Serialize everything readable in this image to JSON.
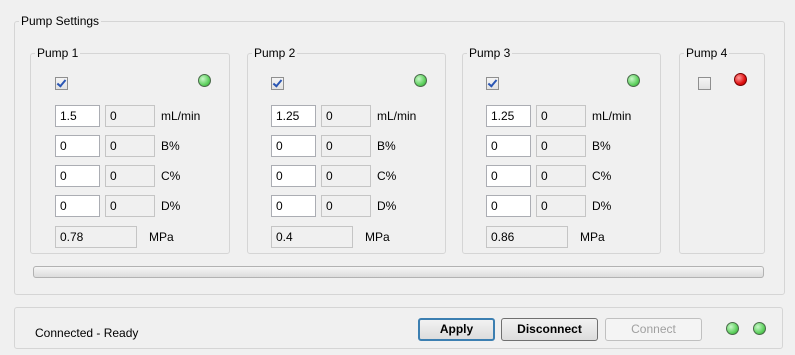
{
  "settings": {
    "title": "Pump Settings"
  },
  "pumps": [
    {
      "title": "Pump 1",
      "enabled": true,
      "status_color": "#5fd15f",
      "rows": [
        {
          "value": "1.5",
          "readback": "0",
          "unit": "mL/min"
        },
        {
          "value": "0",
          "readback": "0",
          "unit": "B%"
        },
        {
          "value": "0",
          "readback": "0",
          "unit": "C%"
        },
        {
          "value": "0",
          "readback": "0",
          "unit": "D%"
        }
      ],
      "pressure": "0.78",
      "pressure_unit": "MPa"
    },
    {
      "title": "Pump 2",
      "enabled": true,
      "status_color": "#5fd15f",
      "rows": [
        {
          "value": "1.25",
          "readback": "0",
          "unit": "mL/min"
        },
        {
          "value": "0",
          "readback": "0",
          "unit": "B%"
        },
        {
          "value": "0",
          "readback": "0",
          "unit": "C%"
        },
        {
          "value": "0",
          "readback": "0",
          "unit": "D%"
        }
      ],
      "pressure": "0.4",
      "pressure_unit": "MPa"
    },
    {
      "title": "Pump 3",
      "enabled": true,
      "status_color": "#5fd15f",
      "rows": [
        {
          "value": "1.25",
          "readback": "0",
          "unit": "mL/min"
        },
        {
          "value": "0",
          "readback": "0",
          "unit": "B%"
        },
        {
          "value": "0",
          "readback": "0",
          "unit": "C%"
        },
        {
          "value": "0",
          "readback": "0",
          "unit": "D%"
        }
      ],
      "pressure": "0.86",
      "pressure_unit": "MPa"
    },
    {
      "title": "Pump 4",
      "enabled": false,
      "status_color": "#e01010"
    }
  ],
  "progress": {
    "value": 0
  },
  "status": {
    "text": "Connected - Ready",
    "apply_label": "Apply",
    "disconnect_label": "Disconnect",
    "connect_label": "Connect",
    "indicator_colors": [
      "#5fd15f",
      "#5fd15f"
    ]
  }
}
